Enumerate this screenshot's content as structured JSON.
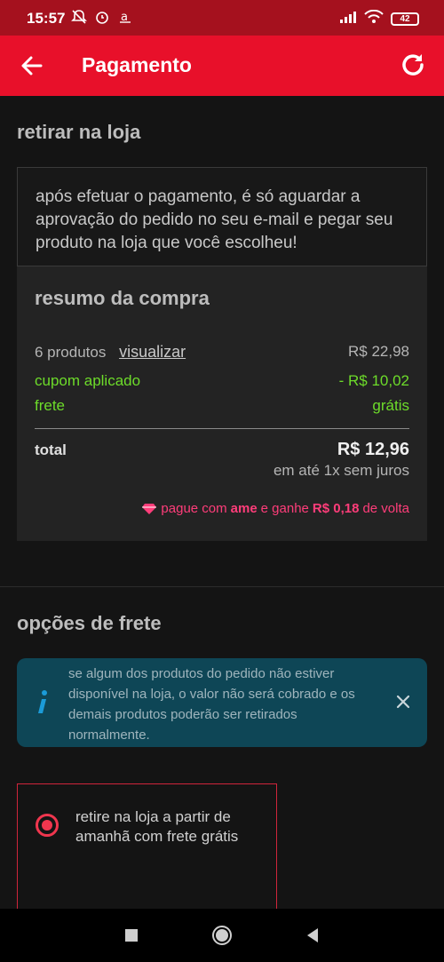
{
  "status_bar": {
    "time": "15:57",
    "battery": "42"
  },
  "app_bar": {
    "title": "Pagamento"
  },
  "pickup": {
    "title": "retirar na loja",
    "message": "após efetuar o pagamento, é só aguardar a aprovação do pedido no seu e-mail e pegar seu produto na loja que você escolheu!"
  },
  "summary": {
    "title": "resumo da compra",
    "products_label": "6 produtos",
    "view_link": "visualizar",
    "products_value": "R$ 22,98",
    "coupon_label": "cupom aplicado",
    "coupon_value": "- R$ 10,02",
    "shipping_label": "frete",
    "shipping_value": "grátis",
    "total_label": "total",
    "total_value": "R$ 12,96",
    "installments": "em até 1x sem juros",
    "ame_prefix": "pague com",
    "ame_brand": "ame",
    "ame_middle": "e ganhe",
    "ame_amount": "R$ 0,18",
    "ame_suffix": "de volta"
  },
  "shipping_options": {
    "title": "opções de frete",
    "notice": "se algum dos produtos do pedido não estiver disponível na loja, o valor não será cobrado e os demais produtos poderão ser retirados normalmente.",
    "option_label": "retire na loja a partir de amanhã com frete grátis"
  },
  "colors": {
    "brand": "#e8102a",
    "accent_green": "#6ddc2a",
    "ame_pink": "#ff3d7a"
  }
}
